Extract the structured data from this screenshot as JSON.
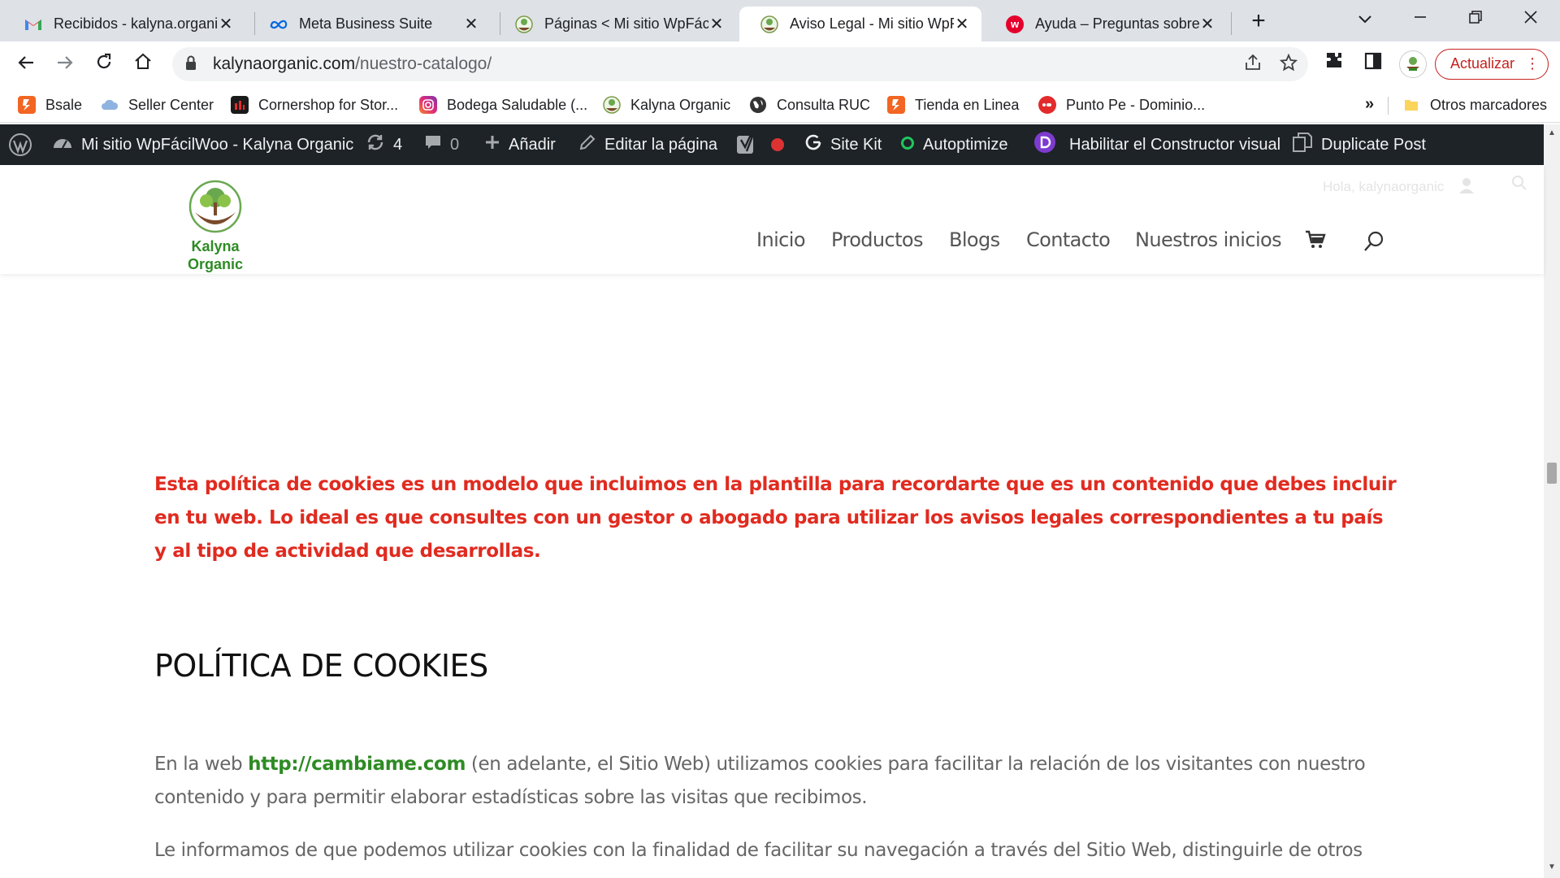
{
  "browser": {
    "tabs": [
      {
        "title": "Recibidos - kalyna.organic",
        "favicon": "gmail-icon",
        "active": false
      },
      {
        "title": "Meta Business Suite",
        "favicon": "meta-icon",
        "active": false
      },
      {
        "title": "Páginas < Mi sitio WpFácil",
        "favicon": "kalyna-icon",
        "active": false
      },
      {
        "title": "Aviso Legal - Mi sitio WpF",
        "favicon": "kalyna-icon",
        "active": true
      },
      {
        "title": "Ayuda – Preguntas sobre",
        "favicon": "wix-icon",
        "active": false
      }
    ],
    "close_glyph": "✕",
    "new_tab_glyph": "+",
    "url_domain": "kalynaorganic.com",
    "url_path": "/nuestro-catalogo/",
    "update_label": "Actualizar",
    "bookmarks": [
      {
        "label": "Bsale",
        "icon": "bsale-icon",
        "color": "#f26522"
      },
      {
        "label": "Seller Center",
        "icon": "cloud-icon",
        "color": "#4a90d9"
      },
      {
        "label": "Cornershop for Stor...",
        "icon": "cornershop-icon",
        "color": "#c8102e"
      },
      {
        "label": "Bodega Saludable (...",
        "icon": "instagram-icon",
        "color": "#d6249f"
      },
      {
        "label": "Kalyna Organic",
        "icon": "kalyna-icon",
        "color": "#5a8f29"
      },
      {
        "label": "Consulta RUC",
        "icon": "globe-icon",
        "color": "#333333"
      },
      {
        "label": "Tienda en Linea",
        "icon": "bsale-icon",
        "color": "#f26522"
      },
      {
        "label": "Punto Pe - Dominio...",
        "icon": "puntope-icon",
        "color": "#e32b2b"
      }
    ],
    "bookmarks_more": "»",
    "other_bookmarks": "Otros marcadores"
  },
  "adminbar": {
    "site_name": "Mi sitio WpFácilWoo - Kalyna Organic",
    "updates_count": "4",
    "comments_count": "0",
    "add_label": "Añadir",
    "edit_label": "Editar la página",
    "sitekit_label": "Site Kit",
    "autoptimize_label": "Autoptimize",
    "divi_label": "Habilitar el Constructor visual",
    "duplicate_label": "Duplicate Post"
  },
  "site": {
    "logo_line1": "Kalyna",
    "logo_line2": "Organic",
    "welcome": "Hola, kalynaorganic",
    "nav": [
      "Inicio",
      "Productos",
      "Blogs",
      "Contacto",
      "Nuestros inicios"
    ]
  },
  "content": {
    "notice": "Esta política de cookies es un modelo que incluimos en la plantilla para recordarte que es un contenido que debes incluir en tu web. Lo ideal es que consultes con un gestor o abogado para utilizar los avisos legales correspondientes a tu país y al tipo de actividad que desarrollas.",
    "heading": "POLÍTICA DE COOKIES",
    "para1_before": "En la web ",
    "para1_link": "http://cambiame.com",
    "para1_after": " (en adelante, el Sitio Web) utilizamos cookies para facilitar la relación de los visitantes con nuestro contenido y para permitir elaborar estadísticas sobre las visitas que recibimos.",
    "para2": "Le informamos de que podemos utilizar cookies con la finalidad de facilitar su navegación a través del Sitio Web, distinguirle de otros"
  },
  "colors": {
    "notice_red": "#e02b20",
    "brand_green": "#2e8b24",
    "adminbar_bg": "#1d2327",
    "update_red": "#c5221f"
  }
}
